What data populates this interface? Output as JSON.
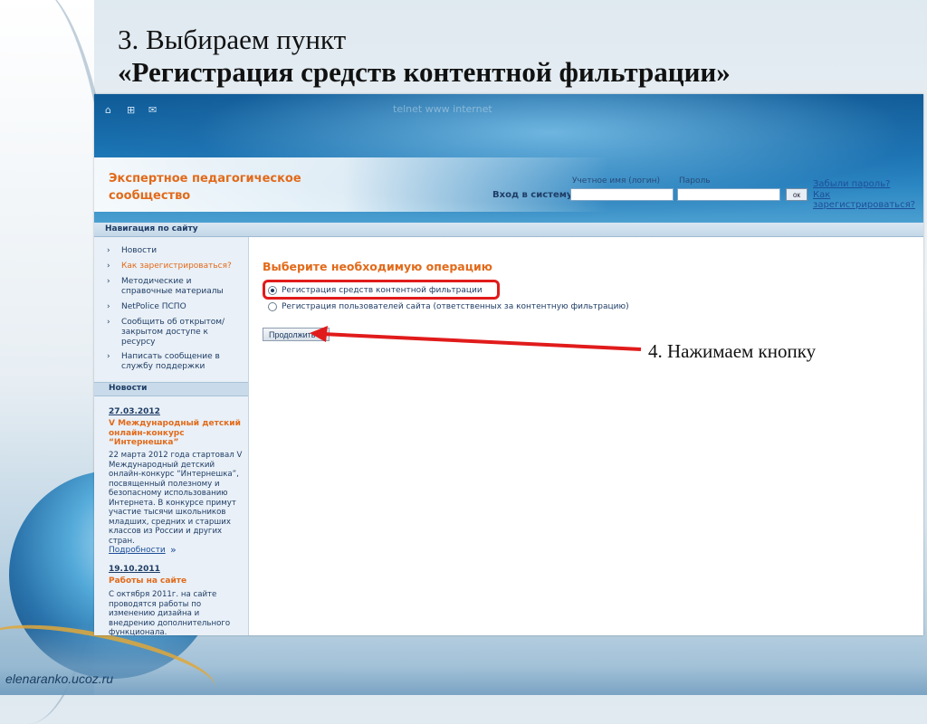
{
  "slide": {
    "title_line1": "3. Выбираем пункт",
    "title_line2": "«Регистрация средств контентной фильтрации»",
    "callout": "4. Нажимаем кнопку",
    "footer_url": "elenaranko.ucoz.ru",
    "annotation_color": "#e11b1b"
  },
  "site": {
    "watermark": "telnet www internet",
    "logo": "Экспертное педагогическое сообщество",
    "login": {
      "label": "Вход в систему:",
      "username_label": "Учетное имя (логин)",
      "password_label": "Пароль",
      "ok_label": "ок",
      "forgot_link": "Забыли пароль?",
      "register_link": "Как зарегистрироваться?"
    },
    "nav_title": "Навигация по сайту",
    "nav_items": [
      {
        "label": "Новости"
      },
      {
        "label": "Как зарегистрироваться?"
      },
      {
        "label": "Методические и справочные материалы"
      },
      {
        "label": "NetPolice ПСПО"
      },
      {
        "label": "Сообщить об открытом/ закрытом доступе к ресурсу"
      },
      {
        "label": "Написать сообщение в службу поддержки"
      }
    ],
    "news_title": "Новости",
    "news": [
      {
        "date": "27.03.2012",
        "headline": "V Международный детский онлайн-конкурс “Интернешка”",
        "body": "22 марта 2012 года стартовал V Международный детский онлайн-конкурс “Интернешка”, посвященный полезному и безопасному использованию Интернета. В конкурсе примут участие тысячи школьников младших, средних и старших классов из России и других стран.",
        "more": "Подробности",
        "more_arrow": "»"
      },
      {
        "date": "19.10.2011",
        "headline": "Работы на сайте",
        "body": "С октября 2011г. на сайте проводятся работы по изменению дизайна и внедрению дополнительного функционала."
      }
    ],
    "main": {
      "heading": "Выберите необходимую операцию",
      "options": [
        {
          "label": "Регистрация средств контентной фильтрации",
          "checked": true
        },
        {
          "label": "Регистрация пользователей сайта (ответственных за контентную фильтрацию)",
          "checked": false
        }
      ],
      "continue_label": "Продолжить"
    },
    "colors": {
      "accent_orange": "#e26a1a",
      "header_blue": "#1b74b3",
      "text_navy": "#1f3d66"
    }
  }
}
